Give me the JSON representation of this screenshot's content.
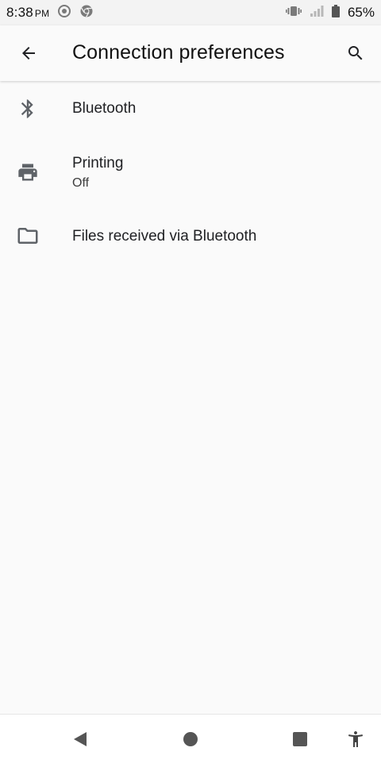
{
  "status_bar": {
    "time": "8:38",
    "ampm": "PM",
    "battery_percent": "65%",
    "icons": [
      "screen-record-icon",
      "chrome-icon",
      "vibrate-icon",
      "signal-icon",
      "battery-icon"
    ]
  },
  "app_bar": {
    "title": "Connection preferences",
    "back_icon": "arrow-back-icon",
    "search_icon": "search-icon"
  },
  "preferences": {
    "items": [
      {
        "title": "Bluetooth",
        "icon": "bluetooth-icon"
      },
      {
        "title": "Printing",
        "summary": "Off",
        "icon": "printer-icon"
      },
      {
        "title": "Files received via Bluetooth",
        "icon": "folder-icon"
      }
    ]
  },
  "nav_bar": {
    "buttons": [
      "back-triangle-icon",
      "home-circle-icon",
      "recents-square-icon",
      "accessibility-icon"
    ]
  },
  "colors": {
    "background": "#fafafa",
    "status_bar": "#f3f3f3",
    "icon": "#5f6368",
    "text": "#202124"
  }
}
